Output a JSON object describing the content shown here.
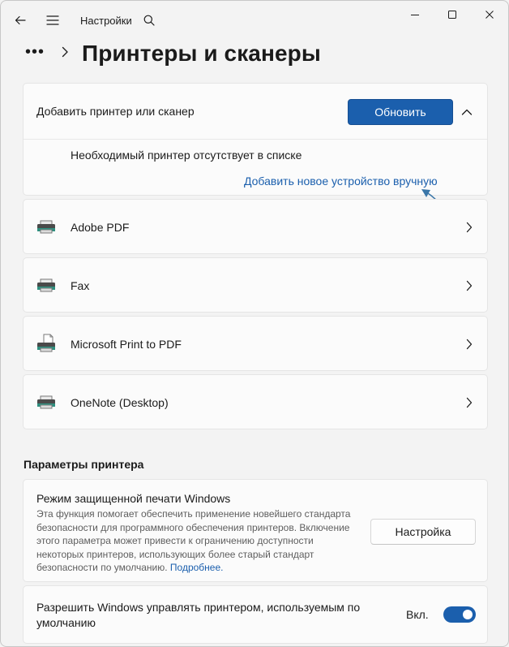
{
  "titlebar": {
    "app_name": "Настройки",
    "back_icon": "back-arrow-icon",
    "menu_icon": "hamburger-menu-icon",
    "search_icon": "search-icon"
  },
  "header": {
    "overflow": "•••",
    "title": "Принтеры и сканеры"
  },
  "add_device": {
    "label": "Добавить принтер или сканер",
    "refresh_button": "Обновить",
    "missing_text": "Необходимый принтер отсутствует в списке",
    "manual_link": "Добавить новое устройство вручную"
  },
  "printers": [
    {
      "name": "Adobe PDF"
    },
    {
      "name": "Fax"
    },
    {
      "name": "Microsoft Print to PDF"
    },
    {
      "name": "OneNote (Desktop)"
    }
  ],
  "printer_settings": {
    "section_title": "Параметры принтера",
    "protected_mode": {
      "title": "Режим защищенной печати Windows",
      "description": "Эта функция помогает обеспечить применение новейшего стандарта безопасности для программного обеспечения принтеров. Включение этого параметра может привести к ограничению доступности некоторых принтеров, использующих более старый стандарт безопасности по умолчанию.",
      "more_link": "Подробнее.",
      "button": "Настройка"
    },
    "default_printer": {
      "title": "Разрешить Windows управлять принтером, используемым по умолчанию",
      "toggle_label": "Вкл.",
      "toggle_on": true
    }
  },
  "colors": {
    "accent": "#1b5fad",
    "background": "#f3f3f3",
    "card": "#fbfbfb"
  }
}
